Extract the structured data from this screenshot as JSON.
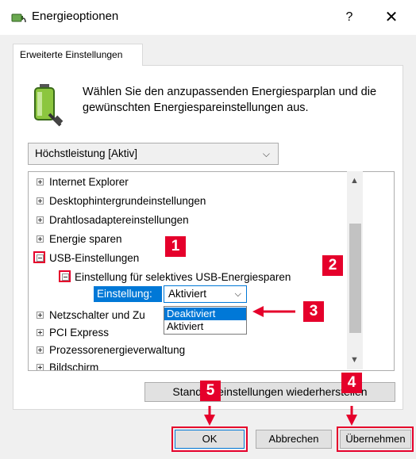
{
  "window": {
    "title": "Energieoptionen",
    "help_label": "?",
    "close_label": "✕",
    "icon": "power-options-icon"
  },
  "tab": {
    "label": "Erweiterte Einstellungen"
  },
  "description": "Wählen Sie den anzupassenden Energiesparplan und die gewünschten Energiespareinstellungen aus.",
  "plan_select": {
    "value": "Höchstleistung [Aktiv]"
  },
  "tree": {
    "items": [
      {
        "label": "Internet Explorer",
        "expanded": false
      },
      {
        "label": "Desktophintergrundeinstellungen",
        "expanded": false
      },
      {
        "label": "Drahtlosadaptereinstellungen",
        "expanded": false
      },
      {
        "label": "Energie sparen",
        "expanded": false
      },
      {
        "label": "USB-Einstellungen",
        "expanded": true
      },
      {
        "label": "Einstellung für selektives USB-Energiesparen",
        "expanded": true
      },
      {
        "label": "Netzschalter und Zu",
        "expanded": false
      },
      {
        "label": "PCI Express",
        "expanded": false
      },
      {
        "label": "Prozessorenergieverwaltung",
        "expanded": false
      },
      {
        "label": "Bildschirm",
        "expanded": false
      }
    ],
    "setting_label": "Einstellung:",
    "setting_value": "Aktiviert",
    "setting_options": [
      "Deaktiviert",
      "Aktiviert"
    ],
    "setting_selected_option": "Deaktiviert"
  },
  "buttons": {
    "restore": "Standardeinstellungen wiederherstellen",
    "ok": "OK",
    "cancel": "Abbrechen",
    "apply": "Übernehmen"
  },
  "annotations": {
    "color": "#e5002b",
    "badges": [
      "1",
      "2",
      "3",
      "4",
      "5"
    ]
  },
  "colors": {
    "accent": "#0078d7",
    "annotation": "#e5002b"
  }
}
